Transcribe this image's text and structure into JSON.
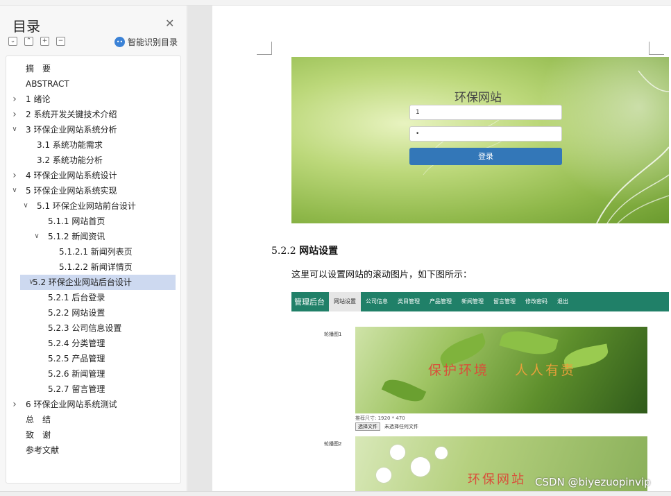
{
  "sidebar": {
    "title": "目录",
    "smart_toc_label": "智能识别目录",
    "tools": [
      "⌄",
      "⌃",
      "+",
      "−"
    ],
    "items": [
      {
        "label": "摘　要",
        "level": 0,
        "chev": ""
      },
      {
        "label": "ABSTRACT",
        "level": 0,
        "chev": ""
      },
      {
        "label": "1 绪论",
        "level": 0,
        "chev": "right"
      },
      {
        "label": "2 系统开发关键技术介绍",
        "level": 0,
        "chev": "right"
      },
      {
        "label": "3 环保企业网站系统分析",
        "level": 0,
        "chev": "down"
      },
      {
        "label": "3.1 系统功能需求",
        "level": 1,
        "chev": ""
      },
      {
        "label": "3.2 系统功能分析",
        "level": 1,
        "chev": ""
      },
      {
        "label": "4 环保企业网站系统设计",
        "level": 0,
        "chev": "right"
      },
      {
        "label": "5 环保企业网站系统实现",
        "level": 0,
        "chev": "down"
      },
      {
        "label": "5.1 环保企业网站前台设计",
        "level": 1,
        "chev": "down"
      },
      {
        "label": "5.1.1 网站首页",
        "level": 2,
        "chev": ""
      },
      {
        "label": "5.1.2 新闻资讯",
        "level": 2,
        "chev": "down"
      },
      {
        "label": "5.1.2.1 新闻列表页",
        "level": 3,
        "chev": ""
      },
      {
        "label": "5.1.2.2 新闻详情页",
        "level": 3,
        "chev": ""
      },
      {
        "label": "5.2 环保企业网站后台设计",
        "level": 1,
        "chev": "down",
        "selected": true
      },
      {
        "label": "5.2.1 后台登录",
        "level": 2,
        "chev": ""
      },
      {
        "label": "5.2.2 网站设置",
        "level": 2,
        "chev": ""
      },
      {
        "label": "5.2.3 公司信息设置",
        "level": 2,
        "chev": ""
      },
      {
        "label": "5.2.4 分类管理",
        "level": 2,
        "chev": ""
      },
      {
        "label": "5.2.5 产品管理",
        "level": 2,
        "chev": ""
      },
      {
        "label": "5.2.6 新闻管理",
        "level": 2,
        "chev": ""
      },
      {
        "label": "5.2.7 留言管理",
        "level": 2,
        "chev": ""
      },
      {
        "label": "6 环保企业网站系统测试",
        "level": 0,
        "chev": "right"
      },
      {
        "label": "总　结",
        "level": 0,
        "chev": ""
      },
      {
        "label": "致　谢",
        "level": 0,
        "chev": ""
      },
      {
        "label": "参考文献",
        "level": 0,
        "chev": ""
      }
    ]
  },
  "document": {
    "login": {
      "title": "环保网站",
      "username_value": "1",
      "password_value": "•",
      "login_button": "登录"
    },
    "heading_num": "5.2.2",
    "heading_text": "网站设置",
    "paragraph": "这里可以设置网站的滚动图片，如下图所示：",
    "admin": {
      "brand": "管理后台",
      "nav": [
        "网站设置",
        "公司信息",
        "类目管理",
        "产品管理",
        "新闻管理",
        "留言管理",
        "修改密码",
        "退出"
      ],
      "active_nav": 0,
      "banner1_label": "轮播图1",
      "banner1_text_a": "保护环境",
      "banner1_text_b": "人人有责",
      "size_hint": "推荐尺寸: 1920 * 470",
      "file_button": "选择文件",
      "file_status": "未选择任何文件",
      "banner2_label": "轮播图2",
      "banner2_text": "环保网站"
    }
  },
  "watermark": "CSDN @biyezuopinvip",
  "colors": {
    "nav": "#208068",
    "login_button": "#3377b8",
    "selected": "#cdd9f0"
  }
}
